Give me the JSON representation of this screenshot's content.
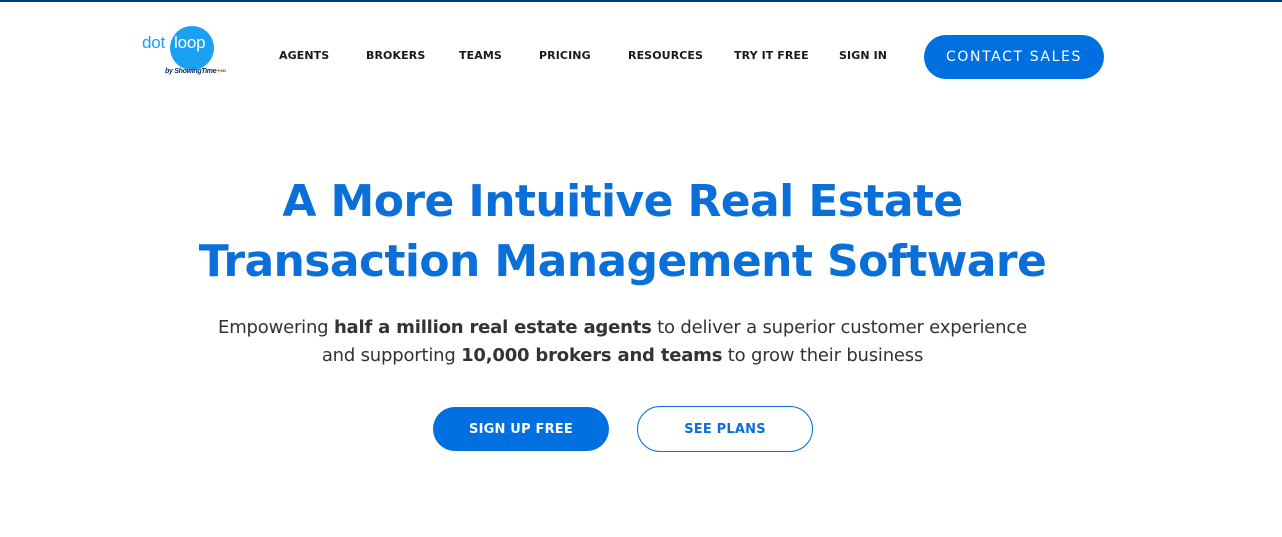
{
  "brand": {
    "logo_dot": "dot",
    "logo_loop": "loop",
    "logo_by": "by",
    "logo_partner": "ShowingTime",
    "logo_plus": "+",
    "logo_sm": "SM",
    "primary_color": "#0070e0",
    "logo_color": "#1ca0f2",
    "top_bar_color": "#003f7d"
  },
  "nav": {
    "items": [
      {
        "label": "AGENTS"
      },
      {
        "label": "BROKERS"
      },
      {
        "label": "TEAMS"
      },
      {
        "label": "PRICING"
      },
      {
        "label": "RESOURCES"
      },
      {
        "label": "TRY IT FREE"
      },
      {
        "label": "SIGN IN"
      }
    ],
    "cta_label": "CONTACT SALES"
  },
  "hero": {
    "title_line1": "A More Intuitive Real Estate",
    "title_line2": "Transaction Management Software",
    "subtitle": {
      "part1": "Empowering ",
      "bold1": "half a million real estate agents",
      "part2": " to deliver a superior customer experience",
      "part3": "and supporting ",
      "bold2": "10,000 brokers and teams",
      "part4": " to grow their business"
    },
    "primary_button": "SIGN UP FREE",
    "secondary_button": "SEE PLANS"
  }
}
